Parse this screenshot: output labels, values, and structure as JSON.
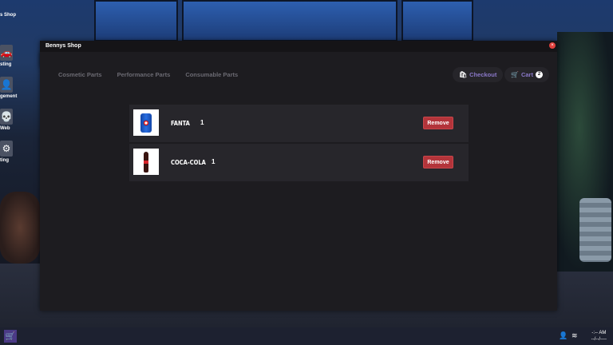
{
  "desktop": {
    "icons": [
      {
        "label": "s Shop",
        "icon": "shopping-cart-icon",
        "glyph": "🛒"
      },
      {
        "label": "sting",
        "icon": "car-icon",
        "glyph": "🚗"
      },
      {
        "label": "gement",
        "icon": "user-icon",
        "glyph": "👤"
      },
      {
        "label": "Web",
        "icon": "skull-icon",
        "glyph": "💀"
      },
      {
        "label": "ting",
        "icon": "gear-icon",
        "glyph": "⚙"
      }
    ]
  },
  "window": {
    "title": "Bennys Shop",
    "close_glyph": "×"
  },
  "tabs": [
    "Cosmetic Parts",
    "Performance Parts",
    "Consumable Parts"
  ],
  "actions": {
    "checkout_label": "Checkout",
    "cart_label": "Cart",
    "cart_count": "2"
  },
  "cart_items": [
    {
      "name": "FANTA",
      "quantity": "1",
      "remove_label": "Remove",
      "image": "pepsi-can"
    },
    {
      "name": "COCA-COLA",
      "quantity": "1",
      "remove_label": "Remove",
      "image": "cola-bottle"
    }
  ],
  "taskbar": {
    "start_icon": "shopping-cart-icon",
    "clock_time": "-:-- AM",
    "clock_date": "--/--/----"
  },
  "colors": {
    "accent": "#8a78c8",
    "remove_button": "#b3343a",
    "panel": "#1d1c20"
  }
}
